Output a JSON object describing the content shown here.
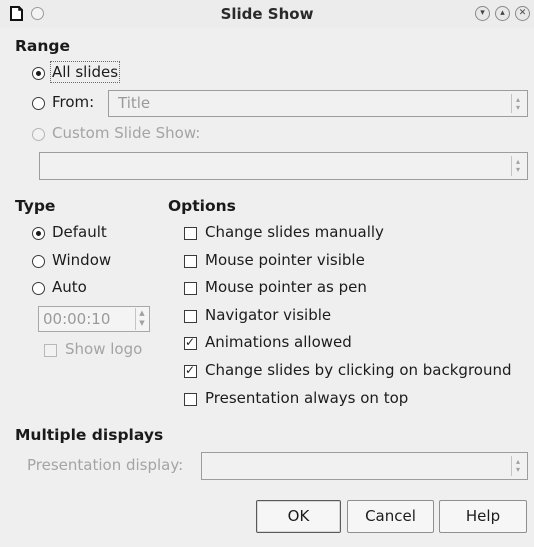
{
  "window": {
    "title": "Slide Show"
  },
  "range": {
    "heading": "Range",
    "all_slides": "All slides",
    "from_label": "From:",
    "from_value": "Title",
    "custom_label": "Custom Slide Show:",
    "custom_value": ""
  },
  "type": {
    "heading": "Type",
    "default": "Default",
    "window": "Window",
    "auto": "Auto",
    "pause_value": "00:00:10",
    "show_logo": "Show logo"
  },
  "options": {
    "heading": "Options",
    "items": [
      {
        "label": "Change slides manually",
        "checked": false
      },
      {
        "label": "Mouse pointer visible",
        "checked": false
      },
      {
        "label": "Mouse pointer as pen",
        "checked": false
      },
      {
        "label": "Navigator visible",
        "checked": false
      },
      {
        "label": "Animations allowed",
        "checked": true
      },
      {
        "label": "Change slides by clicking on background",
        "checked": true
      },
      {
        "label": "Presentation always on top",
        "checked": false
      }
    ]
  },
  "displays": {
    "heading": "Multiple displays",
    "presentation_label": "Presentation display:",
    "presentation_value": ""
  },
  "buttons": {
    "ok": "OK",
    "cancel": "Cancel",
    "help": "Help"
  },
  "icons": {
    "app": "document-icon",
    "menu": "window-menu-icon",
    "minimize": "minimize-icon",
    "maximize": "maximize-icon",
    "close": "close-icon"
  }
}
